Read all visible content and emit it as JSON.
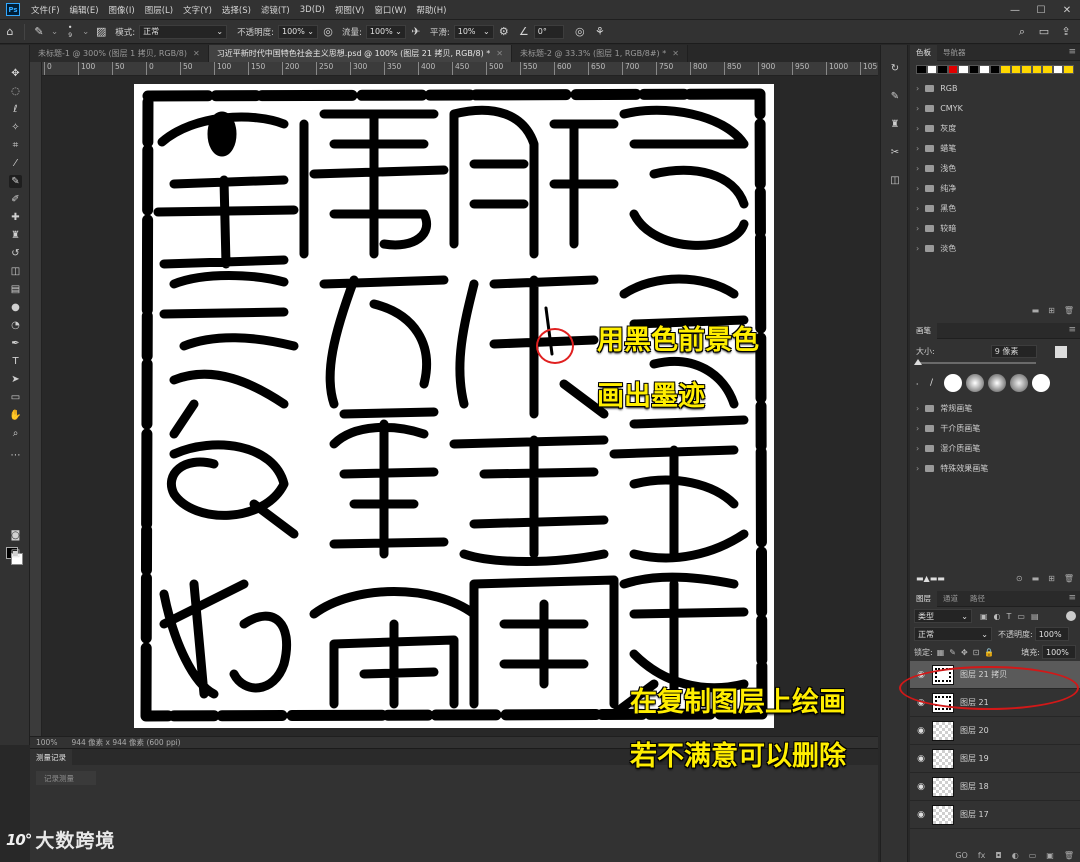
{
  "menubar": {
    "logo": "Ps",
    "items": [
      "文件(F)",
      "编辑(E)",
      "图像(I)",
      "图层(L)",
      "文字(Y)",
      "选择(S)",
      "滤镜(T)",
      "3D(D)",
      "视图(V)",
      "窗口(W)",
      "帮助(H)"
    ],
    "controls": [
      "—",
      "☐",
      "✕"
    ]
  },
  "options": {
    "brush_size": "9",
    "mode_label": "模式:",
    "mode_value": "正常",
    "opacity_label": "不透明度:",
    "opacity_value": "100%",
    "flow_label": "流量:",
    "flow_value": "100%",
    "smoothing_label": "平滑:",
    "smoothing_value": "10%",
    "angle_value": "0°"
  },
  "tabs": [
    {
      "label": "未标题-1 @ 300% (图层 1 拷贝, RGB/8)",
      "close": "✕"
    },
    {
      "label": "习近平新时代中国特色社会主义思想.psd @ 100% (图层 21 拷贝, RGB/8) *",
      "close": "✕"
    },
    {
      "label": "未标题-2 @ 33.3% (图层 1, RGB/8#) *",
      "close": "✕"
    }
  ],
  "ruler": {
    "ticks": [
      "0",
      "100",
      "50",
      "0",
      "50",
      "100",
      "150",
      "200",
      "250",
      "300",
      "350",
      "400",
      "450",
      "500",
      "550",
      "600",
      "650",
      "700",
      "750",
      "800",
      "850",
      "900",
      "950",
      "1000",
      "1050"
    ]
  },
  "status": {
    "zoom": "100%",
    "doc_info": "944 像素 x 944 像素 (600 ppi)"
  },
  "history": {
    "tab": "测量记录",
    "row": "记录测量"
  },
  "watermark": {
    "mark": "10°",
    "text": "大数跨境"
  },
  "swatches_panel": {
    "tabs": [
      "色板",
      "导航器"
    ],
    "colors": [
      "#000000",
      "#ffffff",
      "#000000",
      "#e00000",
      "#ffffff",
      "#000000",
      "#ffffff",
      "#000000",
      "#ffd800",
      "#ffd800",
      "#ffd800",
      "#ffd800",
      "#ffd800",
      "#ffffff",
      "#ffd800"
    ],
    "groups": [
      "RGB",
      "CMYK",
      "灰度",
      "蜡笔",
      "浅色",
      "纯净",
      "黑色",
      "较暗",
      "淡色"
    ]
  },
  "brush_panel": {
    "title": "画笔",
    "size_label": "大小:",
    "size_value": "9 像素",
    "groups": [
      "常规画笔",
      "干介质画笔",
      "湿介质画笔",
      "特殊效果画笔"
    ]
  },
  "layers_panel": {
    "tabs": [
      "图层",
      "通道",
      "路径"
    ],
    "filter": "类型",
    "blend": "正常",
    "opacity_label": "不透明度:",
    "opacity_value": "100%",
    "lock_label": "锁定:",
    "fill_label": "填充:",
    "fill_value": "100%",
    "layers": [
      {
        "name": "图层 21 拷贝",
        "active": true
      },
      {
        "name": "图层 21",
        "active": false
      },
      {
        "name": "图层 20",
        "active": false
      },
      {
        "name": "图层 19",
        "active": false
      },
      {
        "name": "图层 18",
        "active": false
      },
      {
        "name": "图层 17",
        "active": false
      }
    ],
    "footer": [
      "GO",
      "fx",
      "◘",
      "◐",
      "▭",
      "▣",
      "🗑"
    ]
  },
  "annotations": {
    "brush_note_line1": "用黑色前景色",
    "brush_note_line2": "画出墨迹",
    "layer_note_line1": "在复制图层上绘画",
    "layer_note_line2": "若不满意可以删除"
  },
  "accent_colors": {
    "callout_text": "#ffee00",
    "callout_ring": "#e02020"
  }
}
